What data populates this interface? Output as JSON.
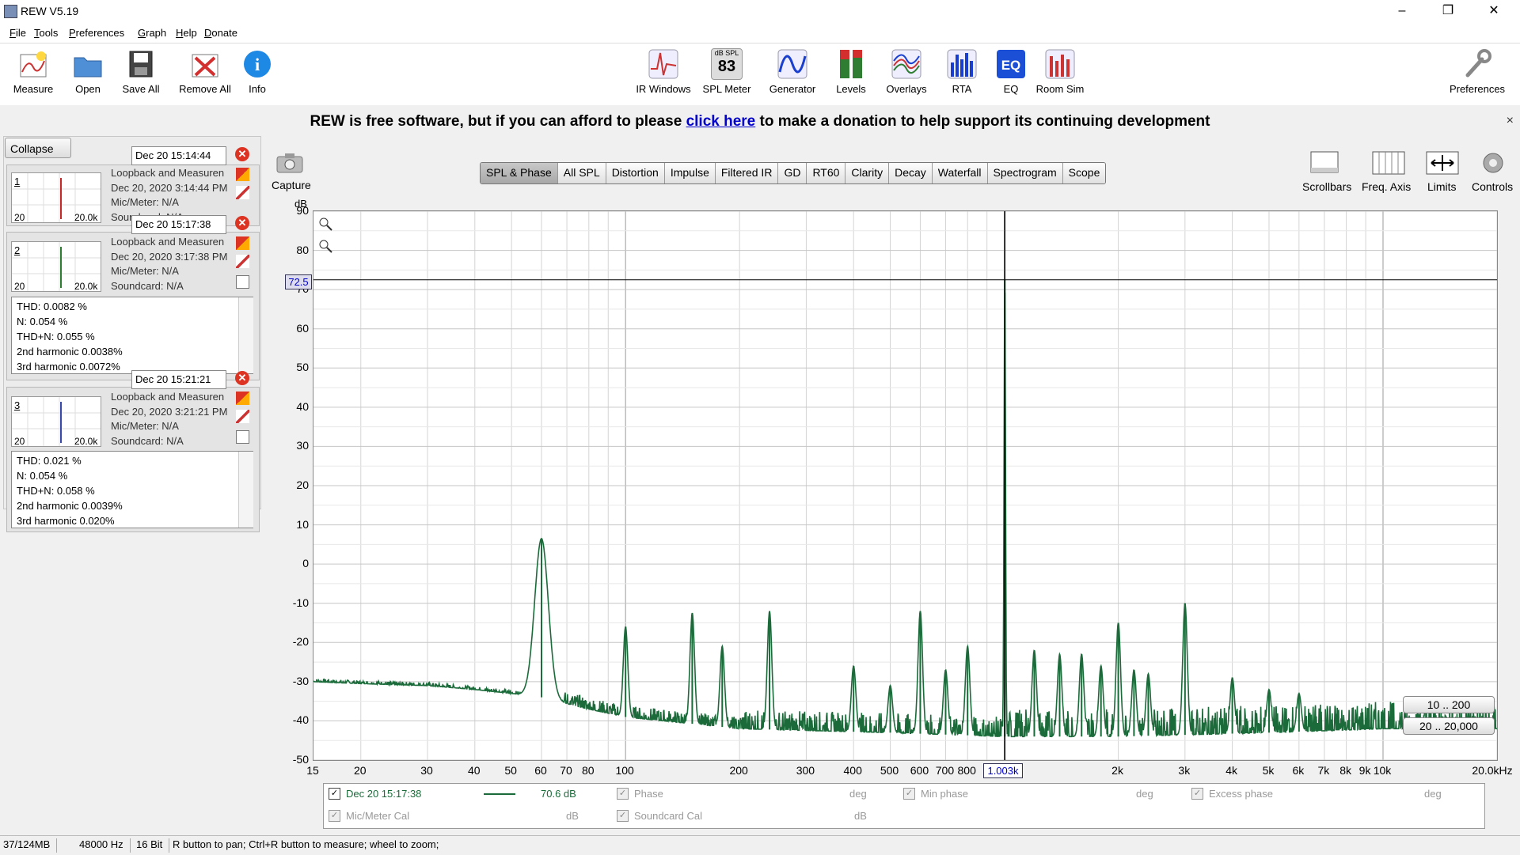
{
  "window": {
    "title": "REW V5.19",
    "min": "–",
    "max": "❐",
    "close": "✕"
  },
  "menu": [
    "File",
    "Tools",
    "Preferences",
    "Graph",
    "Help",
    "Donate"
  ],
  "toolbar": {
    "left": [
      "Measure",
      "Open",
      "Save All",
      "Remove All",
      "Info"
    ],
    "center": [
      "IR Windows",
      "SPL Meter",
      "Generator",
      "Levels",
      "Overlays",
      "RTA",
      "EQ",
      "Room Sim"
    ],
    "right": "Preferences",
    "spl_small": "dB SPL",
    "spl_value": "83"
  },
  "donation": {
    "before": "REW is free software, but if you can afford to please ",
    "link": "click here",
    "after": " to make a donation to help support its continuing development",
    "close": "×"
  },
  "panel": {
    "collapse": "Collapse",
    "capture": "Capture",
    "measurements": [
      {
        "num": "1",
        "date": "Dec 20 15:14:44",
        "lines": [
          "Loopback and Measuren",
          "Dec 20, 2020 3:14:44 PM",
          "Mic/Meter: N/A",
          "Soundcard: N/A"
        ],
        "xmin": "20",
        "xmax": "20.0k",
        "color": "#c62828"
      },
      {
        "num": "2",
        "date": "Dec 20 15:17:38",
        "lines": [
          "Loopback and Measuren",
          "Dec 20, 2020 3:17:38 PM",
          "Mic/Meter: N/A",
          "Soundcard: N/A"
        ],
        "xmin": "20",
        "xmax": "20.0k",
        "color": "#2e7d32",
        "stats": [
          "THD: 0.0082 %",
          "N: 0.054 %",
          "THD+N: 0.055 %",
          "2nd harmonic 0.0038%",
          "3rd harmonic 0.0072%"
        ]
      },
      {
        "num": "3",
        "date": "Dec 20 15:21:21",
        "lines": [
          "Loopback and Measuren",
          "Dec 20, 2020 3:21:21 PM",
          "Mic/Meter: N/A",
          "Soundcard: N/A"
        ],
        "xmin": "20",
        "xmax": "20.0k",
        "color": "#3949ab",
        "stats": [
          "THD: 0.021 %",
          "N: 0.054 %",
          "THD+N: 0.058 %",
          "2nd harmonic 0.0039%",
          "3rd harmonic 0.020%"
        ]
      }
    ]
  },
  "tabs": [
    "SPL & Phase",
    "All SPL",
    "Distortion",
    "Impulse",
    "Filtered IR",
    "GD",
    "RT60",
    "Clarity",
    "Decay",
    "Waterfall",
    "Spectrogram",
    "Scope"
  ],
  "selected_tab": "SPL & Phase",
  "graph_controls": [
    "Scrollbars",
    "Freq. Axis",
    "Limits",
    "Controls"
  ],
  "chart_data": {
    "type": "line",
    "ylabel": "dB",
    "ylim": [
      -50,
      90
    ],
    "yticks": [
      "90",
      "80",
      "70",
      "60",
      "50",
      "40",
      "30",
      "20",
      "10",
      "0",
      "-10",
      "-20",
      "-30",
      "-40",
      "-50"
    ],
    "xscale": "log",
    "xlim": [
      15,
      20000
    ],
    "xticks": [
      {
        "v": 15,
        "l": "15"
      },
      {
        "v": 20,
        "l": "20"
      },
      {
        "v": 30,
        "l": "30"
      },
      {
        "v": 40,
        "l": "40"
      },
      {
        "v": 50,
        "l": "50"
      },
      {
        "v": 60,
        "l": "60"
      },
      {
        "v": 70,
        "l": "70"
      },
      {
        "v": 80,
        "l": "80"
      },
      {
        "v": 100,
        "l": "100"
      },
      {
        "v": 200,
        "l": "200"
      },
      {
        "v": 300,
        "l": "300"
      },
      {
        "v": 400,
        "l": "400"
      },
      {
        "v": 500,
        "l": "500"
      },
      {
        "v": 600,
        "l": "600"
      },
      {
        "v": 700,
        "l": "700"
      },
      {
        "v": 800,
        "l": "800"
      },
      {
        "v": 2000,
        "l": "2k"
      },
      {
        "v": 3000,
        "l": "3k"
      },
      {
        "v": 4000,
        "l": "4k"
      },
      {
        "v": 5000,
        "l": "5k"
      },
      {
        "v": 6000,
        "l": "6k"
      },
      {
        "v": 7000,
        "l": "7k"
      },
      {
        "v": 8000,
        "l": "8k"
      },
      {
        "v": 9000,
        "l": "9k"
      },
      {
        "v": 10000,
        "l": "10k"
      },
      {
        "v": 20000,
        "l": "20.0kHz"
      }
    ],
    "cursor": {
      "x_label": "1.003k",
      "y_label": "72.5",
      "x": 1003,
      "y": 72.5
    },
    "series": [
      {
        "color": "#1b6b3a",
        "noise_floor": [
          [
            15,
            -30
          ],
          [
            20,
            -30.5
          ],
          [
            30,
            -31
          ],
          [
            40,
            -32
          ],
          [
            50,
            -33
          ],
          [
            60,
            -34
          ],
          [
            80,
            -37
          ],
          [
            100,
            -39
          ],
          [
            200,
            -42
          ],
          [
            500,
            -43
          ],
          [
            1000,
            -44
          ],
          [
            2000,
            -44
          ],
          [
            5000,
            -43
          ],
          [
            10000,
            -42
          ],
          [
            20000,
            -42
          ]
        ],
        "peaks": [
          [
            60,
            6.5
          ],
          [
            100,
            -16
          ],
          [
            150,
            -12.5
          ],
          [
            180,
            -21
          ],
          [
            240,
            -12
          ],
          [
            400,
            -26
          ],
          [
            500,
            -31
          ],
          [
            600,
            -12
          ],
          [
            700,
            -27
          ],
          [
            800,
            -21
          ],
          [
            1003,
            72.5
          ],
          [
            1200,
            -22
          ],
          [
            1400,
            -23
          ],
          [
            1600,
            -23
          ],
          [
            1800,
            -26
          ],
          [
            2000,
            -15
          ],
          [
            2200,
            -27
          ],
          [
            2400,
            -28
          ],
          [
            3000,
            -10
          ],
          [
            4000,
            -29
          ],
          [
            5000,
            -32
          ],
          [
            6000,
            -33
          ]
        ]
      }
    ]
  },
  "range_buttons": [
    "10 .. 200",
    "20 .. 20,000"
  ],
  "legend": {
    "rows": [
      [
        {
          "label": "Dec 20 15:17:38",
          "checked": true,
          "active": true,
          "value": "70.6 dB"
        },
        {
          "label": "Phase",
          "unit": "deg"
        },
        {
          "label": "Min phase",
          "unit": "deg"
        },
        {
          "label": "Excess phase",
          "unit": "deg"
        }
      ],
      [
        {
          "label": "Mic/Meter Cal",
          "unit": "dB"
        },
        {
          "label": "Soundcard Cal",
          "unit": "dB"
        }
      ]
    ]
  },
  "status": {
    "memory": "37/124MB",
    "rate": "48000 Hz",
    "bits": "16 Bit",
    "hint": "R button to pan; Ctrl+R button to measure; wheel to zoom;"
  }
}
